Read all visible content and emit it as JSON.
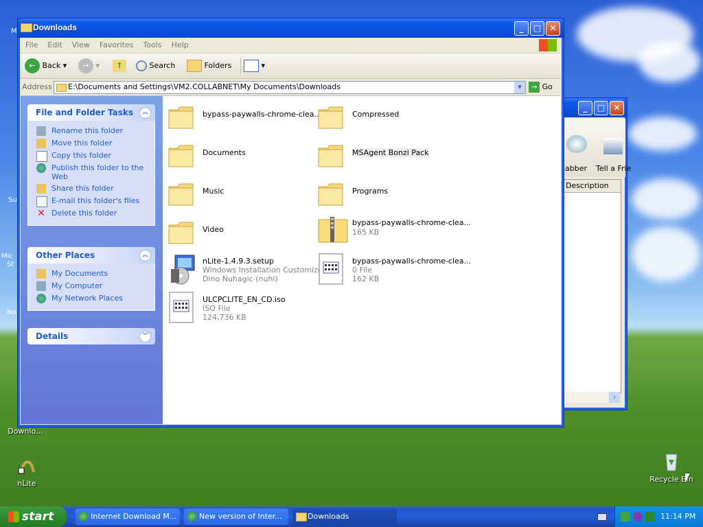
{
  "desktop": {
    "icons": [
      {
        "label": "nLite",
        "icon": "nlite-icon"
      },
      {
        "label": "Recycle Bin",
        "icon": "recycle-bin-icon"
      },
      {
        "label": "Downlo...",
        "icon": "download-icon"
      }
    ],
    "edge_labels": [
      "M",
      "Su",
      "Mic",
      "St",
      "No"
    ]
  },
  "explorer": {
    "title": "Downloads",
    "menu": [
      "File",
      "Edit",
      "View",
      "Favorites",
      "Tools",
      "Help"
    ],
    "toolbar": {
      "back": "Back",
      "search": "Search",
      "folders": "Folders"
    },
    "address": {
      "label": "Address",
      "value": "E:\\Documents and Settings\\VM2.COLLABNET\\My Documents\\Downloads",
      "go": "Go"
    },
    "panels": {
      "tasks": {
        "title": "File and Folder Tasks",
        "items": [
          "Rename this folder",
          "Move this folder",
          "Copy this folder",
          "Publish this folder to the Web",
          "Share this folder",
          "E-mail this folder's files",
          "Delete this folder"
        ]
      },
      "places": {
        "title": "Other Places",
        "items": [
          "My Documents",
          "My Computer",
          "My Network Places"
        ]
      },
      "details": {
        "title": "Details"
      }
    },
    "files": [
      {
        "name": "bypass-paywalls-chrome-clea...",
        "type": "folder"
      },
      {
        "name": "Compressed",
        "type": "folder"
      },
      {
        "name": "Documents",
        "type": "folder"
      },
      {
        "name": "MSAgent Bonzi Pack",
        "type": "folder"
      },
      {
        "name": "Music",
        "type": "folder"
      },
      {
        "name": "Programs",
        "type": "folder"
      },
      {
        "name": "Video",
        "type": "folder"
      },
      {
        "name": "bypass-paywalls-chrome-clea...",
        "type": "zip",
        "size": "165 KB"
      },
      {
        "name": "nLite-1.4.9.3.setup",
        "type": "setup",
        "desc": "Windows Installation Customizer",
        "author": "Dino Nuhagic (nuhi)"
      },
      {
        "name": "bypass-paywalls-chrome-clea...",
        "type": "file",
        "desc": "0 File",
        "size": "162 KB"
      },
      {
        "name": "ULCPCLITE_EN_CD.iso",
        "type": "file",
        "desc": "ISO File",
        "size": "124,736 KB"
      }
    ]
  },
  "background_window": {
    "toolbar_labels": [
      "abber",
      "Tell a Frie"
    ],
    "column_header": "Description"
  },
  "taskbar": {
    "start": "start",
    "items": [
      "Internet Download M...",
      "New version of Inter...",
      "Downloads"
    ],
    "clock": "11:14 PM"
  },
  "colors": {
    "accent": "#0a52e1",
    "link": "#215dc6",
    "start_green": "#2f8a2f"
  }
}
